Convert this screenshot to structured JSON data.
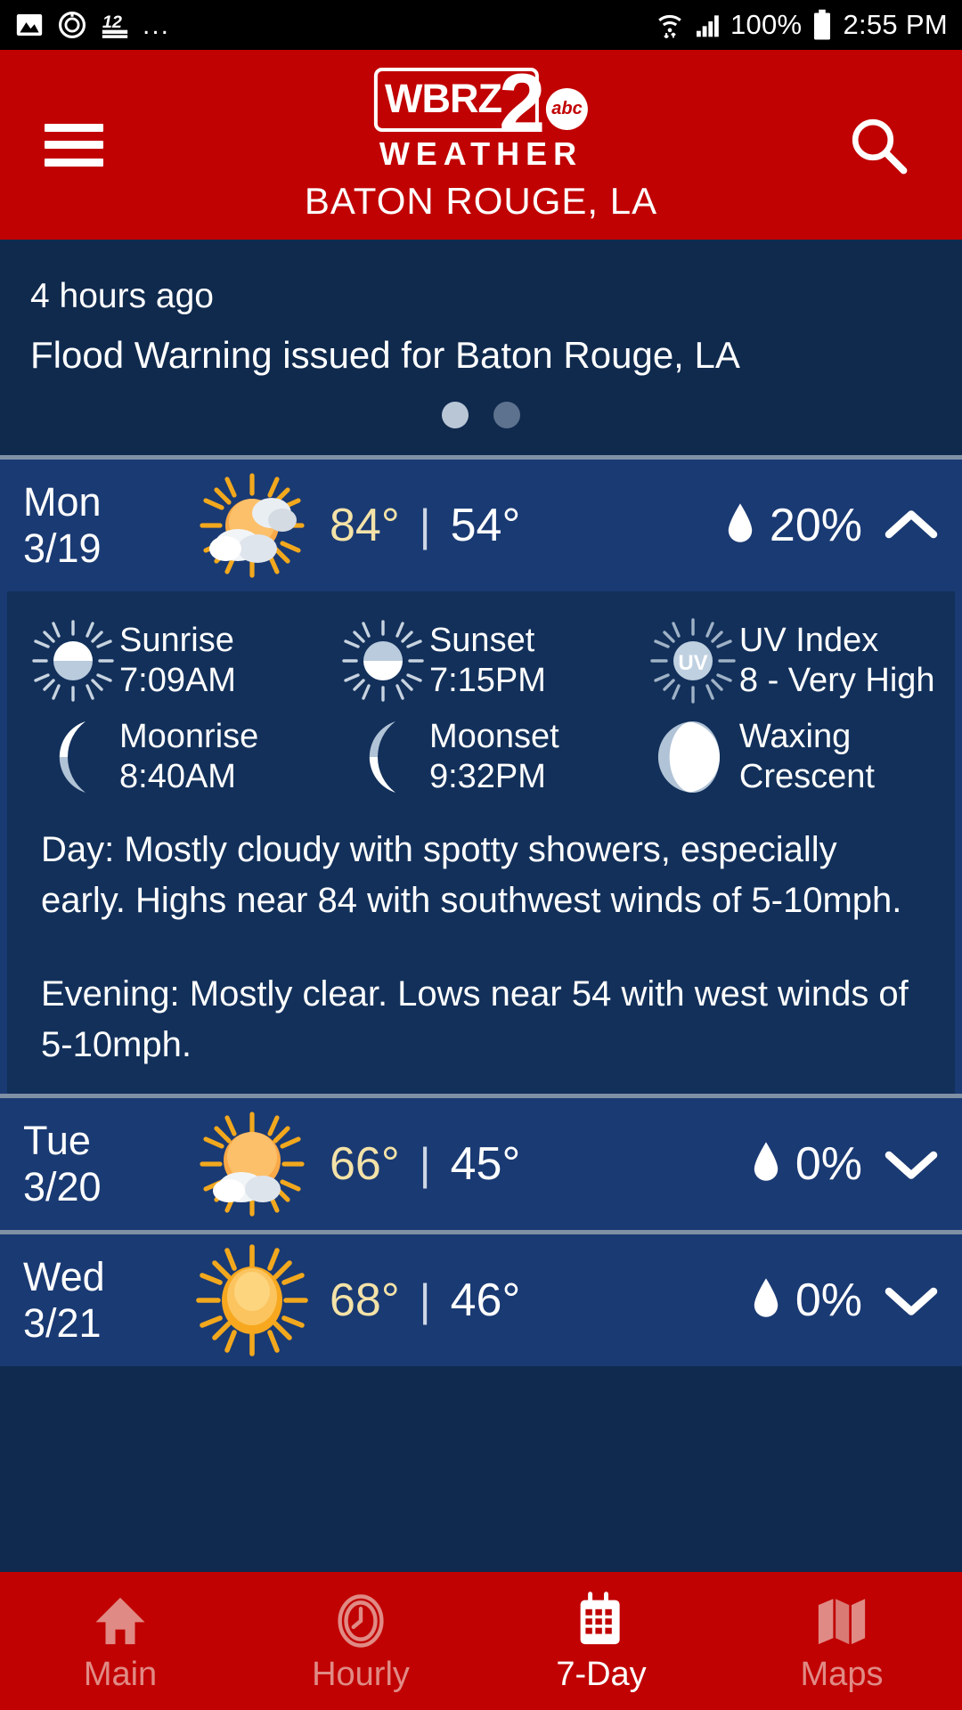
{
  "status_bar": {
    "icons": [
      "image-icon",
      "alarm-icon",
      "channel-12-icon",
      "overflow-dots-icon"
    ],
    "overflow": "...",
    "wifi": "wifi-icon",
    "signal": "cell-signal-icon",
    "battery_text": "100%",
    "battery": "battery-full-icon",
    "time": "2:55 PM"
  },
  "header": {
    "menu": "hamburger-menu-icon",
    "search": "search-icon",
    "logo_main": "WBRZ",
    "logo_channel": "2",
    "logo_network": "abc",
    "logo_sub": "WEATHER",
    "city": "BATON ROUGE, LA",
    "brand_red": "#c10202"
  },
  "alert": {
    "time_ago": "4 hours ago",
    "headline": "Flood Warning issued for Baton Rouge, LA",
    "page_count": 2,
    "active_page": 0,
    "bg": "#102a4e"
  },
  "days": [
    {
      "day": "Mon",
      "date": "3/19",
      "icon": "partly-cloudy-sun-icon",
      "high": "84°",
      "low": "54°",
      "separator": "|",
      "precip": "20%",
      "precip_icon": "water-droplet-icon",
      "chevron": "chevron-up-icon",
      "expanded": true,
      "astro": [
        {
          "icon": "sunrise-icon",
          "label": "Sunrise",
          "value": "7:09AM"
        },
        {
          "icon": "sunset-icon",
          "label": "Sunset",
          "value": "7:15PM"
        },
        {
          "icon": "uv-index-icon",
          "label": "UV Index",
          "value": "8 - Very High"
        },
        {
          "icon": "moonrise-icon",
          "label": "Moonrise",
          "value": "8:40AM"
        },
        {
          "icon": "moonset-icon",
          "label": "Moonset",
          "value": "9:32PM"
        },
        {
          "icon": "moon-phase-icon",
          "label": "Waxing",
          "value": "Crescent"
        }
      ],
      "forecast_day": "Day: Mostly cloudy with spotty showers, especially early. Highs near 84 with southwest winds of 5-10mph.",
      "forecast_evening": "Evening: Mostly clear. Lows near 54 with west winds of 5-10mph."
    },
    {
      "day": "Tue",
      "date": "3/20",
      "icon": "sun-behind-cloud-icon",
      "high": "66°",
      "low": "45°",
      "separator": "|",
      "precip": "0%",
      "precip_icon": "water-droplet-icon",
      "chevron": "chevron-down-icon",
      "expanded": false
    },
    {
      "day": "Wed",
      "date": "3/21",
      "icon": "sunny-icon",
      "high": "68°",
      "low": "46°",
      "separator": "|",
      "precip": "0%",
      "precip_icon": "water-droplet-icon",
      "chevron": "chevron-down-icon",
      "expanded": false
    }
  ],
  "bottom_nav": [
    {
      "label": "Main",
      "icon": "home-icon",
      "active": false
    },
    {
      "label": "Hourly",
      "icon": "clock-icon",
      "active": false
    },
    {
      "label": "7-Day",
      "icon": "calendar-icon",
      "active": true
    },
    {
      "label": "Maps",
      "icon": "map-icon",
      "active": false
    }
  ],
  "colors": {
    "brand_red": "#c10202",
    "alert_navy": "#102a4e",
    "row_navy": "#1a3a73",
    "detail_navy": "#12305a",
    "high_temp": "#f4e3a8",
    "divider": "#8091a5",
    "nav_inactive": "#e08a85"
  }
}
